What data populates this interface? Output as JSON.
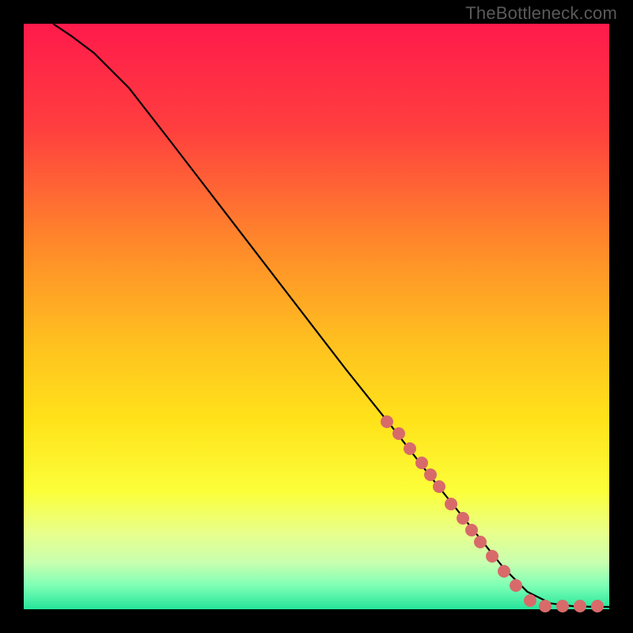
{
  "watermark": "TheBottleneck.com",
  "chart_data": {
    "type": "line",
    "title": "",
    "xlabel": "",
    "ylabel": "",
    "xlim": [
      0,
      100
    ],
    "ylim": [
      0,
      100
    ],
    "grid": false,
    "legend": false,
    "series": [
      {
        "name": "curve",
        "color": "#000000",
        "x": [
          5,
          8,
          12,
          18,
          25,
          35,
          45,
          55,
          63,
          70,
          74,
          78,
          82,
          86,
          90,
          94,
          98,
          100
        ],
        "y": [
          100,
          98,
          95,
          89,
          80,
          67,
          54,
          41,
          31,
          22,
          17,
          12,
          7,
          3,
          1,
          0.5,
          0.4,
          0.4
        ]
      }
    ],
    "markers": {
      "name": "highlighted-points",
      "color": "#d86a6a",
      "x": [
        62,
        64,
        66,
        68,
        69.5,
        71,
        73,
        75,
        76.5,
        78,
        80,
        82,
        84,
        86.5,
        89,
        92,
        95,
        98
      ],
      "y": [
        32,
        30,
        27.5,
        25,
        23,
        21,
        18,
        15.5,
        13.5,
        11.5,
        9,
        6.5,
        4,
        1.5,
        0.6,
        0.5,
        0.5,
        0.5
      ]
    },
    "background_gradient": {
      "stops": [
        {
          "pos": 0.0,
          "color": "#ff1a4b"
        },
        {
          "pos": 0.18,
          "color": "#ff3f3f"
        },
        {
          "pos": 0.38,
          "color": "#ff8a2a"
        },
        {
          "pos": 0.55,
          "color": "#ffc21f"
        },
        {
          "pos": 0.68,
          "color": "#ffe31a"
        },
        {
          "pos": 0.8,
          "color": "#fbff3a"
        },
        {
          "pos": 0.87,
          "color": "#e8ff8c"
        },
        {
          "pos": 0.92,
          "color": "#c9ffb0"
        },
        {
          "pos": 0.96,
          "color": "#7dffb5"
        },
        {
          "pos": 1.0,
          "color": "#24e59a"
        }
      ]
    }
  }
}
